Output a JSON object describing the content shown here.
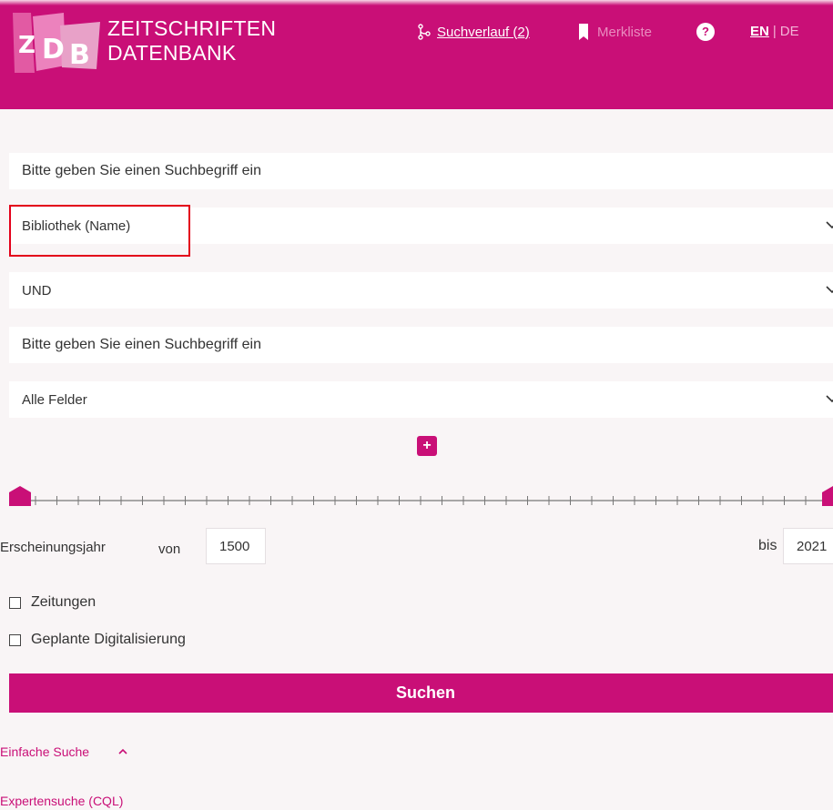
{
  "header": {
    "brand_line1": "ZEITSCHRIFTEN",
    "brand_line2": "DATENBANK",
    "search_history": "Suchverlauf (2)",
    "bookmarks": "Merkliste",
    "help": "?",
    "lang_en": "EN",
    "lang_sep": "|",
    "lang_de": "DE"
  },
  "form": {
    "term1_placeholder": "Bitte geben Sie einen Suchbegriff ein",
    "field1_selected": "Bibliothek (Name)",
    "operator_selected": "UND",
    "term2_placeholder": "Bitte geben Sie einen Suchbegriff ein",
    "field2_selected": "Alle Felder",
    "add_row": "+",
    "year_label": "Erscheinungsjahr",
    "from_label": "von",
    "from_value": "1500",
    "to_label": "bis",
    "to_value": "2021",
    "checkbox_newspapers": "Zeitungen",
    "checkbox_digitization": "Geplante Digitalisierung",
    "search_button": "Suchen"
  },
  "links": {
    "simple_search": "Einfache Suche",
    "expert_search": "Expertensuche (CQL)"
  },
  "colors": {
    "brand": "#c90f77",
    "highlight": "#e3001a"
  }
}
